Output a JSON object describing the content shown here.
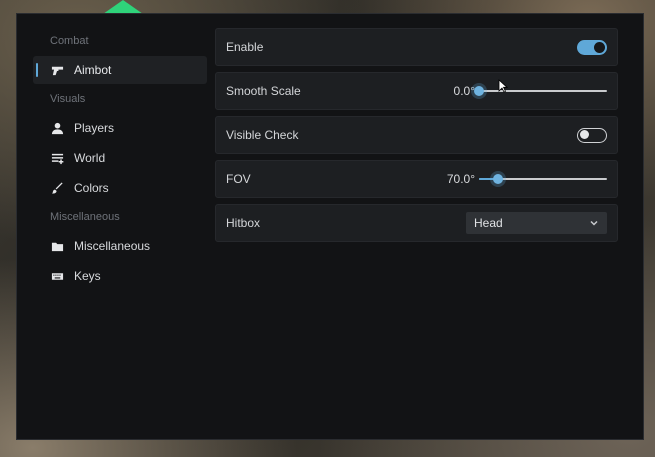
{
  "sidebar": {
    "sections": [
      {
        "title": "Combat",
        "items": [
          {
            "label": "Aimbot",
            "icon": "crosshair-gun-icon",
            "active": true
          }
        ]
      },
      {
        "title": "Visuals",
        "items": [
          {
            "label": "Players",
            "icon": "user-icon"
          },
          {
            "label": "World",
            "icon": "list-add-icon"
          },
          {
            "label": "Colors",
            "icon": "brush-icon"
          }
        ]
      },
      {
        "title": "Miscellaneous",
        "items": [
          {
            "label": "Miscellaneous",
            "icon": "folder-icon"
          },
          {
            "label": "Keys",
            "icon": "keyboard-icon"
          }
        ]
      }
    ]
  },
  "settings": {
    "enable": {
      "label": "Enable",
      "state": true
    },
    "smooth_scale": {
      "label": "Smooth Scale",
      "value_text": "0.0°",
      "fraction": 0.0
    },
    "visible_check": {
      "label": "Visible Check",
      "state": false
    },
    "fov": {
      "label": "FOV",
      "value_text": "70.0°",
      "fraction": 0.15
    },
    "hitbox": {
      "label": "Hitbox",
      "selected": "Head"
    }
  },
  "colors": {
    "accent": "#5fa8d8",
    "window_bg": "#121315",
    "row_bg": "#1d1f22"
  }
}
